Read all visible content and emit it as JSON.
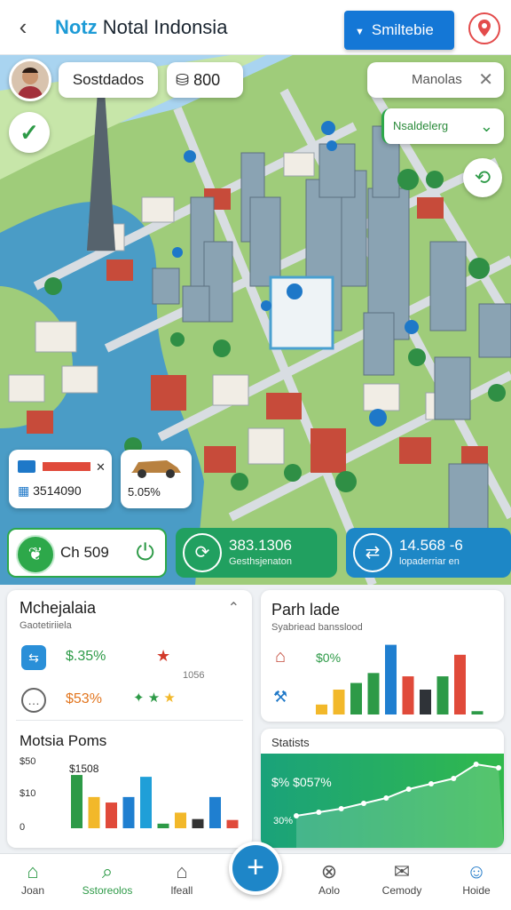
{
  "header": {
    "back_icon": "chevron-left-icon",
    "title_prefix": "Notz",
    "title_rest": "Notal Indonsia",
    "select_label": "Smiltebie",
    "alert_icon": "location-pin-icon"
  },
  "map_overlay": {
    "player_name": "Sostdados",
    "money": "800",
    "money_icon": "coin-stack-icon",
    "search_placeholder": "Manolas",
    "filter_label": "Nsaldelerg",
    "check_icon": "check-icon",
    "route_icon": "route-icon"
  },
  "property_cards": [
    {
      "value": "3514090",
      "icon": "tag-icon"
    },
    {
      "value": "5.05%",
      "icon": "car-icon"
    }
  ],
  "controls": [
    {
      "value": "Ch 509",
      "icon": "leaf-icon",
      "action_icon": "power-icon"
    },
    {
      "value": "383.1306",
      "subtitle": "Gesthsjenaton",
      "icon": "refresh-icon"
    },
    {
      "value": "14.568 -6",
      "subtitle": "lopaderriar en",
      "icon": "swap-icon"
    }
  ],
  "left_panel": {
    "title": "Mchejalaia",
    "subtitle": "Gaotetiriiela",
    "rows": [
      {
        "value": "$.35%",
        "icon": "sliders-icon"
      },
      {
        "value": "$53%",
        "icon": "chat-icon"
      }
    ],
    "side_value": "1056",
    "colors": {
      "green": "#2d9a47",
      "orange": "#e2761f"
    }
  },
  "chart_left": {
    "title": "Motsia Poms",
    "peak_label": "$1508",
    "chart_data": {
      "type": "bar",
      "y_ticks": [
        "$50",
        "$10",
        "0"
      ],
      "values": [
        58,
        34,
        28,
        34,
        56,
        5,
        17,
        10,
        34,
        9
      ],
      "colors": [
        "#2d9a47",
        "#f2b82a",
        "#e04a3a",
        "#1f7fd0",
        "#1f9fd8",
        "#2d9a47",
        "#f2b82a",
        "#333333",
        "#1f7fd0",
        "#e04a3a"
      ]
    }
  },
  "chart_right": {
    "title": "Parh lade",
    "subtitle": "Syabriead bansslood",
    "value_label": "$0%",
    "chart_data": {
      "type": "bar",
      "values": [
        12,
        30,
        38,
        50,
        84,
        46,
        30,
        46,
        72,
        4
      ],
      "colors": [
        "#f2b82a",
        "#f2b82a",
        "#2d9a47",
        "#2d9a47",
        "#1f7fd0",
        "#e04a3a",
        "#2f3338",
        "#2d9a47",
        "#e04a3a",
        "#2d9a47"
      ]
    }
  },
  "stats_panel": {
    "title": "Statists",
    "value_label": "$% $057%",
    "low_label": "30%",
    "chart_data": {
      "type": "area",
      "values": [
        30,
        34,
        38,
        44,
        50,
        60,
        66,
        72,
        88,
        84
      ]
    }
  },
  "bottom_nav": [
    {
      "label": "Joan",
      "icon": "home-icon"
    },
    {
      "label": "Sstoreolos",
      "icon": "search-icon"
    },
    {
      "label": "lfeall",
      "icon": "house-outline-icon"
    },
    {
      "label": "Aolo",
      "icon": "compass-icon"
    },
    {
      "label": "Cemody",
      "icon": "mail-icon"
    },
    {
      "label": "Hoide",
      "icon": "user-icon"
    }
  ],
  "add_icon": "plus-icon"
}
